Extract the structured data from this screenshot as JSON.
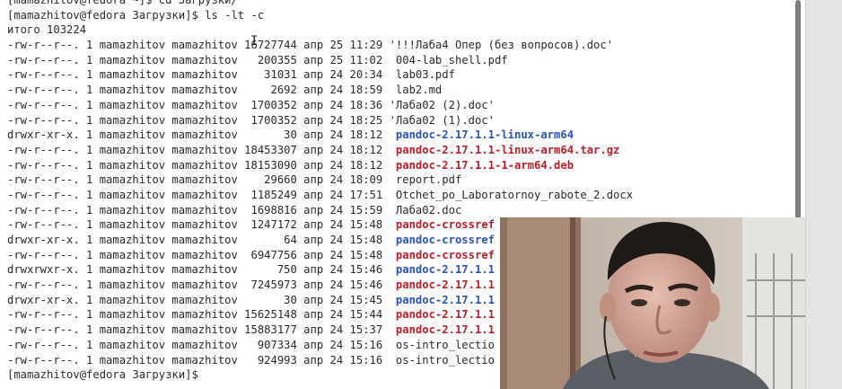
{
  "terminal": {
    "lines": [
      {
        "segments": [
          {
            "t": "[mamazhitov@fedora ~]$ cd Загрузки/",
            "c": ""
          }
        ]
      },
      {
        "segments": [
          {
            "t": "[mamazhitov@fedora Загрузки]$ ls -lt -c",
            "c": ""
          }
        ]
      },
      {
        "segments": [
          {
            "t": "итого 103224",
            "c": ""
          }
        ]
      },
      {
        "segments": [
          {
            "t": "-rw-r--r--. 1 mamazhitov mamazhitov 16727744 апр 25 11:29 '!!!Лаба4 Опер (без вопросов).doc'",
            "c": ""
          }
        ]
      },
      {
        "segments": [
          {
            "t": "-rw-r--r--. 1 mamazhitov mamazhitov   200355 апр 25 11:02  004-lab_shell.pdf",
            "c": ""
          }
        ]
      },
      {
        "segments": [
          {
            "t": "-rw-r--r--. 1 mamazhitov mamazhitov    31031 апр 24 20:34  lab03.pdf",
            "c": ""
          }
        ]
      },
      {
        "segments": [
          {
            "t": "-rw-r--r--. 1 mamazhitov mamazhitov     2692 апр 24 18:59  lab2.md",
            "c": ""
          }
        ]
      },
      {
        "segments": [
          {
            "t": "-rw-r--r--. 1 mamazhitov mamazhitov  1700352 апр 24 18:36 'Лаба02 (2).doc'",
            "c": ""
          }
        ]
      },
      {
        "segments": [
          {
            "t": "-rw-r--r--. 1 mamazhitov mamazhitov  1700352 апр 24 18:25 'Лаба02 (1).doc'",
            "c": ""
          }
        ]
      },
      {
        "segments": [
          {
            "t": "drwxr-xr-x. 1 mamazhitov mamazhitov       30 апр 24 18:12  ",
            "c": ""
          },
          {
            "t": "pandoc-2.17.1.1-linux-arm64",
            "c": "dir"
          }
        ]
      },
      {
        "segments": [
          {
            "t": "-rw-r--r--. 1 mamazhitov mamazhitov 18453307 апр 24 18:12  ",
            "c": ""
          },
          {
            "t": "pandoc-2.17.1.1-linux-arm64.tar.gz",
            "c": "arc"
          }
        ]
      },
      {
        "segments": [
          {
            "t": "-rw-r--r--. 1 mamazhitov mamazhitov 18153090 апр 24 18:12  ",
            "c": ""
          },
          {
            "t": "pandoc-2.17.1.1-1-arm64.deb",
            "c": "arc"
          }
        ]
      },
      {
        "segments": [
          {
            "t": "-rw-r--r--. 1 mamazhitov mamazhitov    29660 апр 24 18:09  report.pdf",
            "c": ""
          }
        ]
      },
      {
        "segments": [
          {
            "t": "-rw-r--r--. 1 mamazhitov mamazhitov  1185249 апр 24 17:51  Otchet_po_Laboratornoy_rabote_2.docx",
            "c": ""
          }
        ]
      },
      {
        "segments": [
          {
            "t": "-rw-r--r--. 1 mamazhitov mamazhitov  1698816 апр 24 15:59  Лаба02.doc",
            "c": ""
          }
        ]
      },
      {
        "segments": [
          {
            "t": "-rw-r--r--. 1 mamazhitov mamazhitov  1247172 апр 24 15:48  ",
            "c": ""
          },
          {
            "t": "pandoc-crossref",
            "c": "arc"
          }
        ]
      },
      {
        "segments": [
          {
            "t": "drwxr-xr-x. 1 mamazhitov mamazhitov       64 апр 24 15:48  ",
            "c": ""
          },
          {
            "t": "pandoc-crossref",
            "c": "dir"
          }
        ]
      },
      {
        "segments": [
          {
            "t": "-rw-r--r--. 1 mamazhitov mamazhitov  6947756 апр 24 15:48  ",
            "c": ""
          },
          {
            "t": "pandoc-crossref",
            "c": "arc"
          }
        ]
      },
      {
        "segments": [
          {
            "t": "drwxrwxr-x. 1 mamazhitov mamazhitov      750 апр 24 15:46  ",
            "c": ""
          },
          {
            "t": "pandoc-2.17.1.1",
            "c": "dir"
          }
        ]
      },
      {
        "segments": [
          {
            "t": "-rw-r--r--. 1 mamazhitov mamazhitov  7245973 апр 24 15:46  ",
            "c": ""
          },
          {
            "t": "pandoc-2.17.1.1",
            "c": "arc"
          }
        ]
      },
      {
        "segments": [
          {
            "t": "drwxr-xr-x. 1 mamazhitov mamazhitov       30 апр 24 15:45  ",
            "c": ""
          },
          {
            "t": "pandoc-2.17.1.1",
            "c": "dir"
          }
        ]
      },
      {
        "segments": [
          {
            "t": "-rw-r--r--. 1 mamazhitov mamazhitov 15625148 апр 24 15:44  ",
            "c": ""
          },
          {
            "t": "pandoc-2.17.1.1",
            "c": "arc"
          }
        ]
      },
      {
        "segments": [
          {
            "t": "-rw-r--r--. 1 mamazhitov mamazhitov 15883177 апр 24 15:37  ",
            "c": ""
          },
          {
            "t": "pandoc-2.17.1.1",
            "c": "arc"
          }
        ]
      },
      {
        "segments": [
          {
            "t": "-rw-r--r--. 1 mamazhitov mamazhitov   907334 апр 24 15:16  os-intro_lectio",
            "c": ""
          }
        ]
      },
      {
        "segments": [
          {
            "t": "-rw-r--r--. 1 mamazhitov mamazhitov   924993 апр 24 15:16  os-intro_lectio",
            "c": ""
          }
        ]
      },
      {
        "segments": [
          {
            "t": "[mamazhitov@fedora Загрузки]$ ",
            "c": ""
          }
        ]
      }
    ]
  },
  "colors": {
    "background": "#ffffff",
    "text": "#2b2b2b",
    "directory": "#2a52be",
    "archive": "#c01c28"
  },
  "icons": {
    "mouse_cursor": "ibeam-cursor-icon"
  }
}
